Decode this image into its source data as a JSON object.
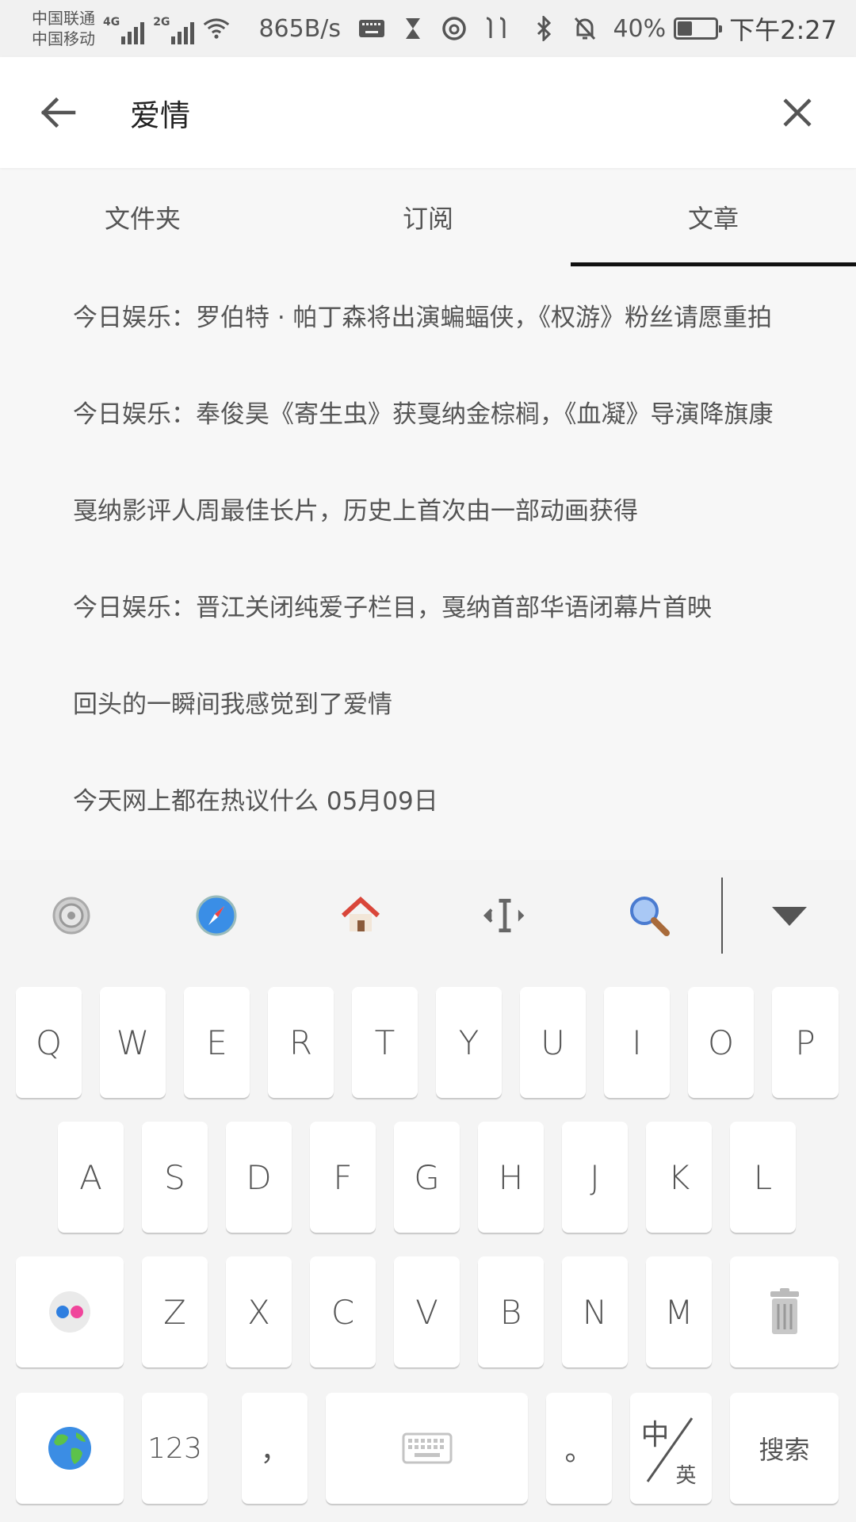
{
  "status_bar": {
    "carrier_1": "中国联通",
    "carrier_2": "中国移动",
    "signal_1_label": "4G",
    "signal_2_label": "2G",
    "net_speed": "865B/s",
    "battery_percent": "40%",
    "battery_level": 0.4,
    "time": "下午2:27",
    "icons": [
      "keyboard-icon",
      "hourglass-icon",
      "netease-music-icon",
      "earbuds-icon",
      "bluetooth-icon",
      "mute-bell-icon"
    ]
  },
  "search": {
    "query": "爱情"
  },
  "tabs": [
    {
      "label": "文件夹",
      "active": false
    },
    {
      "label": "订阅",
      "active": false
    },
    {
      "label": "文章",
      "active": true
    }
  ],
  "articles": [
    "今日娱乐：罗伯特 · 帕丁森将出演蝙蝠侠，《权游》粉丝请愿重拍",
    "今日娱乐：奉俊昊《寄生虫》获戛纳金棕榈，《血凝》导演降旗康",
    "戛纳影评人周最佳长片，历史上首次由一部动画获得",
    "今日娱乐：晋江关闭纯爱子栏目，戛纳首部华语闭幕片首映",
    "回头的一瞬间我感觉到了爱情",
    "今天网上都在热议什么 05月09日"
  ],
  "keyboard": {
    "toolbar_icons": [
      "settings-icon",
      "compass-icon",
      "home-icon",
      "cursor-move-icon",
      "search-icon",
      "collapse-keyboard-icon"
    ],
    "row1": [
      "Q",
      "W",
      "E",
      "R",
      "T",
      "Y",
      "U",
      "I",
      "O",
      "P"
    ],
    "row2": [
      "A",
      "S",
      "D",
      "F",
      "G",
      "H",
      "J",
      "K",
      "L"
    ],
    "row3": [
      "Z",
      "X",
      "C",
      "V",
      "B",
      "N",
      "M"
    ],
    "key_123": "123",
    "key_comma": "，",
    "key_period": "。",
    "key_lang_top": "中",
    "key_lang_bottom": "英",
    "key_search": "搜索"
  },
  "colors": {
    "accent": "#111111",
    "text": "#555555",
    "background": "#f7f7f7"
  }
}
